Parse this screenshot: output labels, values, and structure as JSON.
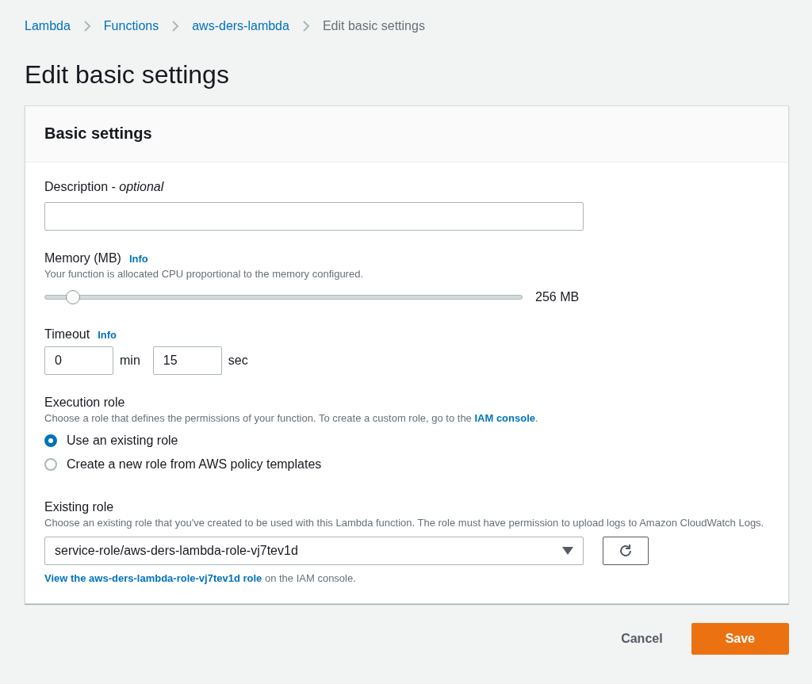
{
  "breadcrumb": [
    {
      "label": "Lambda",
      "link": true
    },
    {
      "label": "Functions",
      "link": true
    },
    {
      "label": "aws-ders-lambda",
      "link": true
    },
    {
      "label": "Edit basic settings",
      "link": false
    }
  ],
  "page_title": "Edit basic settings",
  "panel": {
    "title": "Basic settings",
    "description": {
      "label": "Description - *optional*"
    },
    "memory": {
      "label": "Memory (MB)",
      "info": "Info",
      "help": "Your function is allocated CPU proportional to the memory configured.",
      "level": 0.058,
      "reading": "256 MB"
    },
    "timeout": {
      "label": "Timeout",
      "info": "Info",
      "fields": [
        {
          "value": "0",
          "unit": "min"
        },
        {
          "value": "15",
          "unit": "sec"
        }
      ]
    },
    "execution_role": {
      "label": "Execution role",
      "help": "Choose a role that defines the permissions of your function. To create a custom role, go to the ",
      "help_link": "IAM console",
      "help_after": ".",
      "options": [
        {
          "label": "Use an existing role",
          "selected": true
        },
        {
          "label": "Create a new role from AWS policy templates",
          "selected": false
        }
      ]
    },
    "existing_role": {
      "label": "Existing role",
      "help": "Choose an existing role that you've created to be used with this Lambda function. The role must have permission to upload logs to Amazon CloudWatch Logs.",
      "value": "service-role/aws-ders-lambda-role-vj7tev1d",
      "view_link": "View the aws-ders-lambda-role-vj7tev1d role",
      "view_after": " on the IAM console."
    }
  },
  "buttons": [
    {
      "label": "Cancel",
      "kind": "secondary"
    },
    {
      "label": "Save",
      "kind": "primary"
    }
  ]
}
